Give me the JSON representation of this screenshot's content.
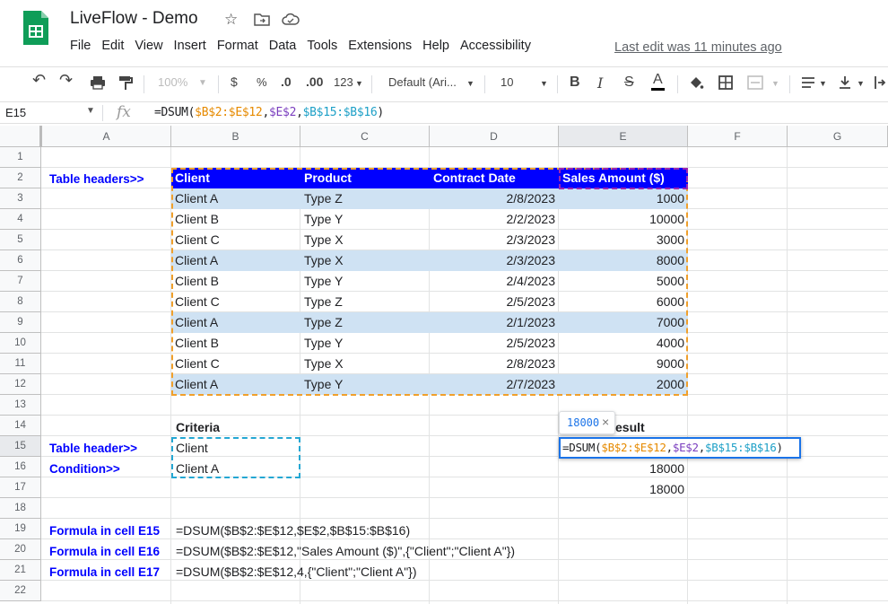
{
  "app": {
    "title": "LiveFlow - Demo",
    "last_edit": "Last edit was 11 minutes ago",
    "menus": [
      "File",
      "Edit",
      "View",
      "Insert",
      "Format",
      "Data",
      "Tools",
      "Extensions",
      "Help",
      "Accessibility"
    ]
  },
  "toolbar": {
    "zoom": "100%",
    "currency": "$",
    "percent": "%",
    "dec_decrease": ".0",
    "dec_increase": ".00",
    "more_formats": "123",
    "font": "Default (Ari...",
    "font_size": "10",
    "bold": "B",
    "italic": "I",
    "strike": "S",
    "text_color": "A"
  },
  "formula_bar": {
    "cell_ref": "E15",
    "fx": "fx",
    "prefix": "=DSUM(",
    "arg1": "$B$2:$E$12",
    "arg2": "$E$2",
    "arg3": "$B$15:$B$16",
    "suffix": ")"
  },
  "columns": [
    "A",
    "B",
    "C",
    "D",
    "E",
    "F",
    "G"
  ],
  "rows": [
    "1",
    "2",
    "3",
    "4",
    "5",
    "6",
    "7",
    "8",
    "9",
    "10",
    "11",
    "12",
    "13",
    "14",
    "15",
    "16",
    "17",
    "18",
    "19",
    "20",
    "21",
    "22"
  ],
  "table": {
    "headers": [
      "Client",
      "Product",
      "Contract Date",
      "Sales Amount ($)"
    ],
    "data": [
      [
        "Client A",
        "Type Z",
        "2/8/2023",
        "1000"
      ],
      [
        "Client B",
        "Type Y",
        "2/2/2023",
        "10000"
      ],
      [
        "Client C",
        "Type X",
        "2/3/2023",
        "3000"
      ],
      [
        "Client A",
        "Type X",
        "2/3/2023",
        "8000"
      ],
      [
        "Client B",
        "Type Y",
        "2/4/2023",
        "5000"
      ],
      [
        "Client C",
        "Type Z",
        "2/5/2023",
        "6000"
      ],
      [
        "Client A",
        "Type Z",
        "2/1/2023",
        "7000"
      ],
      [
        "Client B",
        "Type Y",
        "2/5/2023",
        "4000"
      ],
      [
        "Client C",
        "Type X",
        "2/8/2023",
        "9000"
      ],
      [
        "Client A",
        "Type Y",
        "2/7/2023",
        "2000"
      ]
    ]
  },
  "labels": {
    "table_headers": "Table headers>>",
    "table_header": "Table header>>",
    "condition": "Condition>>",
    "criteria": "Criteria",
    "criteria_value_1": "Client",
    "criteria_value_2": "Client A",
    "result_header": "esult",
    "result_e16": "18000",
    "result_e17": "18000",
    "formula_e15_label": "Formula in cell E15",
    "formula_e16_label": "Formula in cell E16",
    "formula_e17_label": "Formula in cell E17",
    "formula_e15": "=DSUM($B$2:$E$12,$E$2,$B$15:$B$16)",
    "formula_e16": "=DSUM($B$2:$E$12,\"Sales Amount ($)\",{\"Client\";\"Client A\"})",
    "formula_e17": "=DSUM($B$2:$E$12,4,{\"Client\";\"Client A\"})"
  },
  "tooltip": {
    "value": "18000",
    "close": "×"
  },
  "colors": {
    "header_band": "#0000ff",
    "row_band": "#cfe2f3",
    "range_orange": "#e68a00",
    "range_purple": "#7b3fbf",
    "range_cyan": "#1ea0c7",
    "active_cell": "#1a73e8"
  }
}
